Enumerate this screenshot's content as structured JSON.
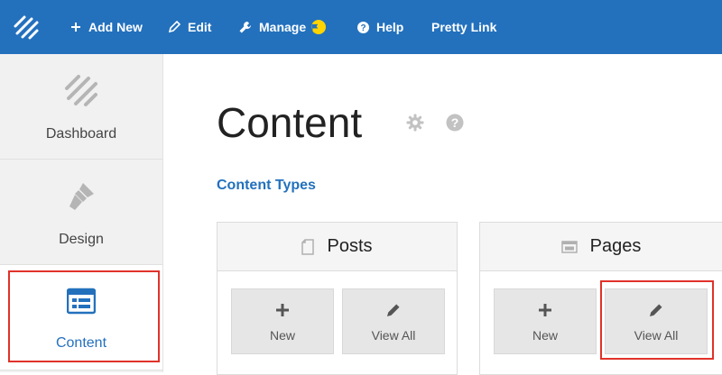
{
  "topbar": {
    "add_new": "Add New",
    "edit": "Edit",
    "manage": "Manage",
    "help": "Help",
    "pretty_link": "Pretty Link",
    "bg_color": "#2371bd"
  },
  "sidebar": {
    "items": [
      {
        "label": "Dashboard",
        "icon": "stripes-logo-icon"
      },
      {
        "label": "Design",
        "icon": "paintbrush-icon"
      },
      {
        "label": "Content",
        "icon": "content-grid-icon",
        "active": true
      }
    ]
  },
  "main": {
    "title": "Content",
    "section_heading": "Content Types",
    "cards": [
      {
        "title": "Posts",
        "icon": "document-icon",
        "new_label": "New",
        "view_all_label": "View All"
      },
      {
        "title": "Pages",
        "icon": "page-layout-icon",
        "new_label": "New",
        "view_all_label": "View All"
      }
    ]
  },
  "colors": {
    "accent": "#2371bd",
    "highlight": "#e0322a",
    "badge": "#ffd400"
  }
}
